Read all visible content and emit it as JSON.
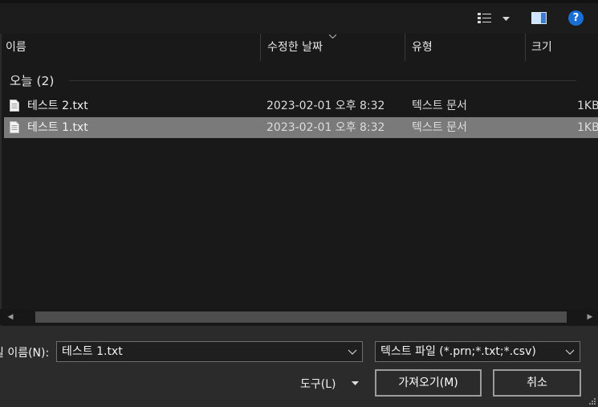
{
  "columns": {
    "name": "이름",
    "modified": "수정한 날짜",
    "type": "유형",
    "size": "크기"
  },
  "group": {
    "label": "오늘 (2)"
  },
  "files": [
    {
      "name": "테스트 2.txt",
      "modified": "2023-02-01 오후 8:32",
      "type": "텍스트 문서",
      "size": "1KB",
      "selected": false
    },
    {
      "name": "테스트 1.txt",
      "modified": "2023-02-01 오후 8:32",
      "type": "텍스트 문서",
      "size": "1KB",
      "selected": true
    }
  ],
  "bottom": {
    "filename_label": "일 이름(N):",
    "filename_value": "테스트 1.txt",
    "filter_value": "텍스트 파일 (*.prn;*.txt;*.csv)",
    "tools_label": "도구(L)",
    "import_button": "가져오기(M)",
    "cancel_button": "취소"
  },
  "toolbar": {
    "view_icon": "list-view-icon",
    "preview_icon": "preview-pane-icon",
    "help_icon": "help-icon",
    "help_glyph": "?"
  },
  "colors": {
    "background": "#191919",
    "selected_row": "#7a7a7a",
    "help_blue": "#1a6fd6"
  }
}
